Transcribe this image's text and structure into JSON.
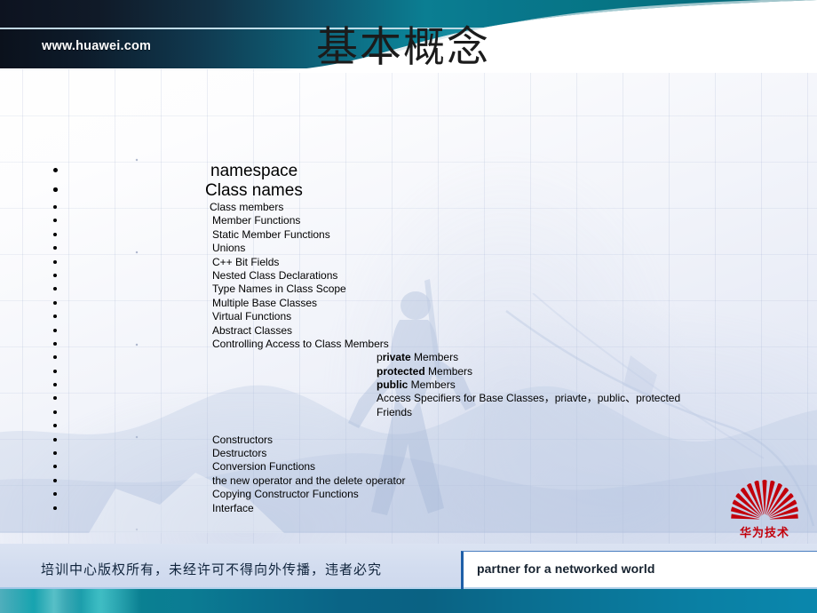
{
  "header": {
    "site_url": "www.huawei.com",
    "title": "基本概念"
  },
  "content": {
    "items": [
      {
        "label": "namespace",
        "indent": 237,
        "size": "big"
      },
      {
        "label": "Class names",
        "indent": 231,
        "size": "big2"
      },
      {
        "label": "Class members",
        "indent": 236,
        "size": "normal"
      },
      {
        "label": "Member Functions",
        "indent": 239,
        "size": "normal"
      },
      {
        "label": "Static Member Functions",
        "indent": 239,
        "size": "normal"
      },
      {
        "label": "Unions",
        "indent": 239,
        "size": "normal"
      },
      {
        "label": "C++ Bit Fields",
        "indent": 239,
        "size": "normal"
      },
      {
        "label": "Nested Class Declarations",
        "indent": 239,
        "size": "normal"
      },
      {
        "label": "Type Names in Class Scope",
        "indent": 239,
        "size": "normal"
      },
      {
        "label": "Multiple Base Classes",
        "indent": 239,
        "size": "normal"
      },
      {
        "label": "Virtual Functions",
        "indent": 239,
        "size": "normal"
      },
      {
        "label": "Abstract Classes",
        "indent": 239,
        "size": "normal"
      },
      {
        "label": "Controlling Access to Class Members",
        "indent": 239,
        "size": "normal"
      },
      {
        "label": "private Members",
        "indent": 424,
        "size": "normal",
        "bold_prefix": "rivate",
        "lead": "p"
      },
      {
        "label": "protected Members",
        "indent": 424,
        "size": "normal",
        "bold_prefix": "protected",
        "lead": ""
      },
      {
        "label": "public Members",
        "indent": 424,
        "size": "normal",
        "bold_prefix": "public",
        "lead": ""
      },
      {
        "label": "Access Specifiers for Base Classes，priavte，public、protected",
        "indent": 424,
        "size": "normal"
      },
      {
        "label": "Friends",
        "indent": 424,
        "size": "normal"
      },
      {
        "label": "",
        "indent": 239,
        "size": "normal"
      },
      {
        "label": "Constructors",
        "indent": 239,
        "size": "normal"
      },
      {
        "label": "Destructors",
        "indent": 239,
        "size": "normal"
      },
      {
        "label": "Conversion Functions",
        "indent": 239,
        "size": "normal"
      },
      {
        "label": "the new operator and the delete operator",
        "indent": 239,
        "size": "normal"
      },
      {
        "label": "Copying  Constructor  Functions",
        "indent": 239,
        "size": "normal"
      },
      {
        "label": "Interface",
        "indent": 239,
        "size": "normal"
      }
    ]
  },
  "logo": {
    "name": "huawei-logo",
    "caption": "华为技术",
    "color": "#c2000b"
  },
  "footer": {
    "copyright": "培训中心版权所有，未经许可不得向外传播，违者必究",
    "tagline": "partner for a networked world"
  },
  "colors": {
    "header_dark": "#0d1320",
    "header_teal": "#0b7e92",
    "accent_blue": "#1e5fa8",
    "logo_red": "#c2000b",
    "footer_band": "#d2dcef"
  }
}
